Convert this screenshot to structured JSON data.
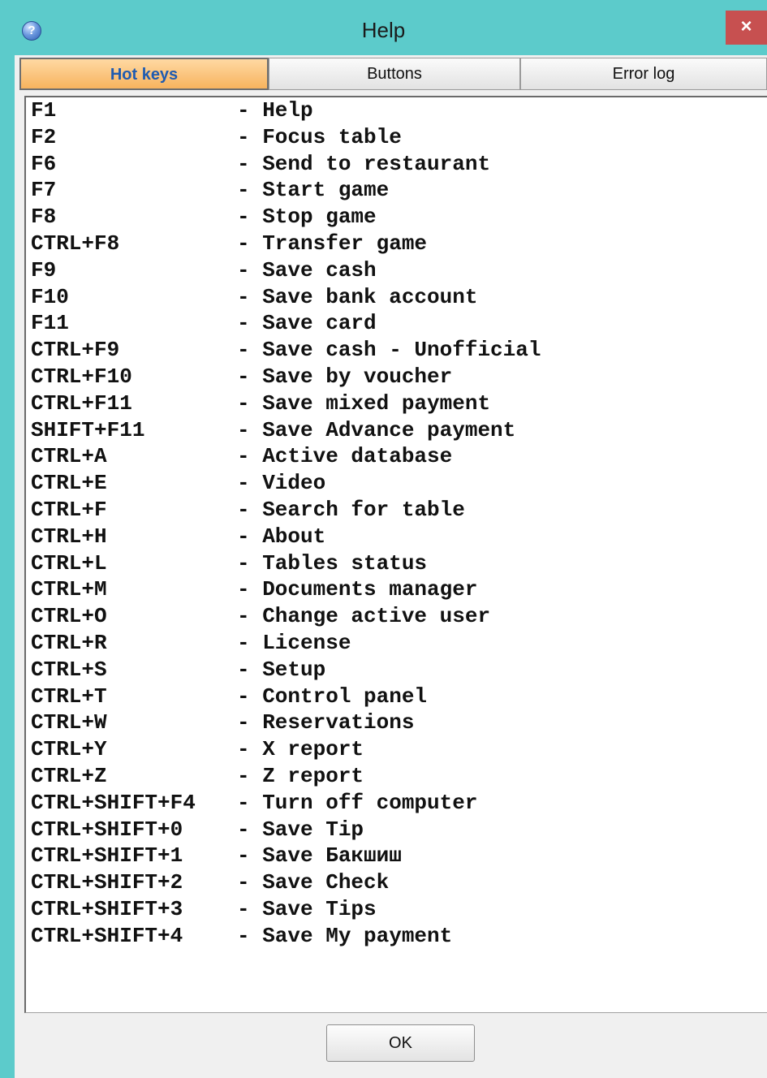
{
  "window": {
    "title": "Help",
    "icon": "help-question-icon",
    "close_glyph": "×"
  },
  "tabs": [
    {
      "label": "Hot keys",
      "active": true
    },
    {
      "label": "Buttons",
      "active": false
    },
    {
      "label": "Error log",
      "active": false
    }
  ],
  "hotkeys": [
    {
      "key": "F1",
      "desc": "- Help"
    },
    {
      "key": "F2",
      "desc": "- Focus table"
    },
    {
      "key": "F6",
      "desc": "- Send to restaurant"
    },
    {
      "key": "F7",
      "desc": "- Start game"
    },
    {
      "key": "F8",
      "desc": "- Stop game"
    },
    {
      "key": "CTRL+F8",
      "desc": "- Transfer game"
    },
    {
      "key": "F9",
      "desc": "- Save cash"
    },
    {
      "key": "F10",
      "desc": "- Save bank account"
    },
    {
      "key": "F11",
      "desc": "- Save card"
    },
    {
      "key": "CTRL+F9",
      "desc": "- Save cash - Unofficial"
    },
    {
      "key": "CTRL+F10",
      "desc": "- Save by voucher"
    },
    {
      "key": "CTRL+F11",
      "desc": "- Save mixed payment"
    },
    {
      "key": "SHIFT+F11",
      "desc": "- Save Advance payment"
    },
    {
      "key": "CTRL+A",
      "desc": "- Active database"
    },
    {
      "key": "CTRL+E",
      "desc": "- Video"
    },
    {
      "key": "CTRL+F",
      "desc": "- Search for table"
    },
    {
      "key": "CTRL+H",
      "desc": "- About"
    },
    {
      "key": "CTRL+L",
      "desc": "- Tables status"
    },
    {
      "key": "CTRL+M",
      "desc": "- Documents manager"
    },
    {
      "key": "CTRL+O",
      "desc": "- Change active user"
    },
    {
      "key": "CTRL+R",
      "desc": "- License"
    },
    {
      "key": "CTRL+S",
      "desc": "- Setup"
    },
    {
      "key": "CTRL+T",
      "desc": "- Control panel"
    },
    {
      "key": "CTRL+W",
      "desc": "- Reservations"
    },
    {
      "key": "CTRL+Y",
      "desc": "- X report"
    },
    {
      "key": "CTRL+Z",
      "desc": "- Z report"
    },
    {
      "key": "CTRL+SHIFT+F4",
      "desc": "- Turn off computer"
    },
    {
      "key": "CTRL+SHIFT+0",
      "desc": "- Save Tip"
    },
    {
      "key": "CTRL+SHIFT+1",
      "desc": "- Save Бакшиш"
    },
    {
      "key": "CTRL+SHIFT+2",
      "desc": "- Save Check"
    },
    {
      "key": "CTRL+SHIFT+3",
      "desc": "- Save Tips"
    },
    {
      "key": "CTRL+SHIFT+4",
      "desc": "- Save My payment"
    }
  ],
  "ok_label": "OK",
  "colors": {
    "window_frame": "#5ccbcb",
    "active_tab": "#f7b35e",
    "active_tab_text": "#1f5bb0",
    "close_button": "#c75050"
  }
}
